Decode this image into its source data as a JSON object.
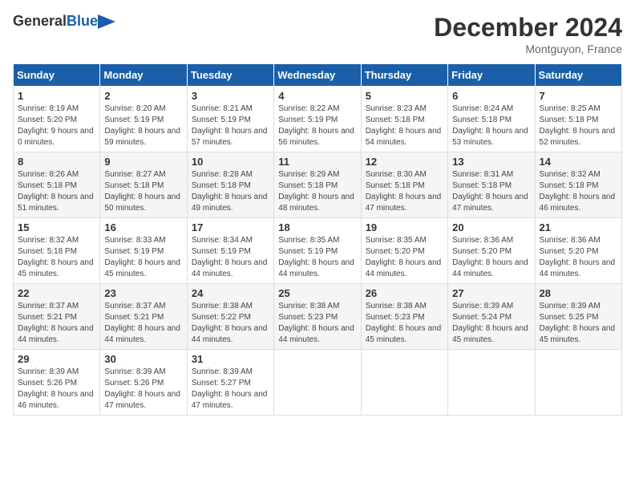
{
  "header": {
    "logo_general": "General",
    "logo_blue": "Blue",
    "month_title": "December 2024",
    "location": "Montguyon, France"
  },
  "days_of_week": [
    "Sunday",
    "Monday",
    "Tuesday",
    "Wednesday",
    "Thursday",
    "Friday",
    "Saturday"
  ],
  "weeks": [
    [
      {
        "day": "1",
        "sunrise": "Sunrise: 8:19 AM",
        "sunset": "Sunset: 5:20 PM",
        "daylight": "Daylight: 9 hours and 0 minutes."
      },
      {
        "day": "2",
        "sunrise": "Sunrise: 8:20 AM",
        "sunset": "Sunset: 5:19 PM",
        "daylight": "Daylight: 8 hours and 59 minutes."
      },
      {
        "day": "3",
        "sunrise": "Sunrise: 8:21 AM",
        "sunset": "Sunset: 5:19 PM",
        "daylight": "Daylight: 8 hours and 57 minutes."
      },
      {
        "day": "4",
        "sunrise": "Sunrise: 8:22 AM",
        "sunset": "Sunset: 5:19 PM",
        "daylight": "Daylight: 8 hours and 56 minutes."
      },
      {
        "day": "5",
        "sunrise": "Sunrise: 8:23 AM",
        "sunset": "Sunset: 5:18 PM",
        "daylight": "Daylight: 8 hours and 54 minutes."
      },
      {
        "day": "6",
        "sunrise": "Sunrise: 8:24 AM",
        "sunset": "Sunset: 5:18 PM",
        "daylight": "Daylight: 8 hours and 53 minutes."
      },
      {
        "day": "7",
        "sunrise": "Sunrise: 8:25 AM",
        "sunset": "Sunset: 5:18 PM",
        "daylight": "Daylight: 8 hours and 52 minutes."
      }
    ],
    [
      {
        "day": "8",
        "sunrise": "Sunrise: 8:26 AM",
        "sunset": "Sunset: 5:18 PM",
        "daylight": "Daylight: 8 hours and 51 minutes."
      },
      {
        "day": "9",
        "sunrise": "Sunrise: 8:27 AM",
        "sunset": "Sunset: 5:18 PM",
        "daylight": "Daylight: 8 hours and 50 minutes."
      },
      {
        "day": "10",
        "sunrise": "Sunrise: 8:28 AM",
        "sunset": "Sunset: 5:18 PM",
        "daylight": "Daylight: 8 hours and 49 minutes."
      },
      {
        "day": "11",
        "sunrise": "Sunrise: 8:29 AM",
        "sunset": "Sunset: 5:18 PM",
        "daylight": "Daylight: 8 hours and 48 minutes."
      },
      {
        "day": "12",
        "sunrise": "Sunrise: 8:30 AM",
        "sunset": "Sunset: 5:18 PM",
        "daylight": "Daylight: 8 hours and 47 minutes."
      },
      {
        "day": "13",
        "sunrise": "Sunrise: 8:31 AM",
        "sunset": "Sunset: 5:18 PM",
        "daylight": "Daylight: 8 hours and 47 minutes."
      },
      {
        "day": "14",
        "sunrise": "Sunrise: 8:32 AM",
        "sunset": "Sunset: 5:18 PM",
        "daylight": "Daylight: 8 hours and 46 minutes."
      }
    ],
    [
      {
        "day": "15",
        "sunrise": "Sunrise: 8:32 AM",
        "sunset": "Sunset: 5:18 PM",
        "daylight": "Daylight: 8 hours and 45 minutes."
      },
      {
        "day": "16",
        "sunrise": "Sunrise: 8:33 AM",
        "sunset": "Sunset: 5:19 PM",
        "daylight": "Daylight: 8 hours and 45 minutes."
      },
      {
        "day": "17",
        "sunrise": "Sunrise: 8:34 AM",
        "sunset": "Sunset: 5:19 PM",
        "daylight": "Daylight: 8 hours and 44 minutes."
      },
      {
        "day": "18",
        "sunrise": "Sunrise: 8:35 AM",
        "sunset": "Sunset: 5:19 PM",
        "daylight": "Daylight: 8 hours and 44 minutes."
      },
      {
        "day": "19",
        "sunrise": "Sunrise: 8:35 AM",
        "sunset": "Sunset: 5:20 PM",
        "daylight": "Daylight: 8 hours and 44 minutes."
      },
      {
        "day": "20",
        "sunrise": "Sunrise: 8:36 AM",
        "sunset": "Sunset: 5:20 PM",
        "daylight": "Daylight: 8 hours and 44 minutes."
      },
      {
        "day": "21",
        "sunrise": "Sunrise: 8:36 AM",
        "sunset": "Sunset: 5:20 PM",
        "daylight": "Daylight: 8 hours and 44 minutes."
      }
    ],
    [
      {
        "day": "22",
        "sunrise": "Sunrise: 8:37 AM",
        "sunset": "Sunset: 5:21 PM",
        "daylight": "Daylight: 8 hours and 44 minutes."
      },
      {
        "day": "23",
        "sunrise": "Sunrise: 8:37 AM",
        "sunset": "Sunset: 5:21 PM",
        "daylight": "Daylight: 8 hours and 44 minutes."
      },
      {
        "day": "24",
        "sunrise": "Sunrise: 8:38 AM",
        "sunset": "Sunset: 5:22 PM",
        "daylight": "Daylight: 8 hours and 44 minutes."
      },
      {
        "day": "25",
        "sunrise": "Sunrise: 8:38 AM",
        "sunset": "Sunset: 5:23 PM",
        "daylight": "Daylight: 8 hours and 44 minutes."
      },
      {
        "day": "26",
        "sunrise": "Sunrise: 8:38 AM",
        "sunset": "Sunset: 5:23 PM",
        "daylight": "Daylight: 8 hours and 45 minutes."
      },
      {
        "day": "27",
        "sunrise": "Sunrise: 8:39 AM",
        "sunset": "Sunset: 5:24 PM",
        "daylight": "Daylight: 8 hours and 45 minutes."
      },
      {
        "day": "28",
        "sunrise": "Sunrise: 8:39 AM",
        "sunset": "Sunset: 5:25 PM",
        "daylight": "Daylight: 8 hours and 45 minutes."
      }
    ],
    [
      {
        "day": "29",
        "sunrise": "Sunrise: 8:39 AM",
        "sunset": "Sunset: 5:26 PM",
        "daylight": "Daylight: 8 hours and 46 minutes."
      },
      {
        "day": "30",
        "sunrise": "Sunrise: 8:39 AM",
        "sunset": "Sunset: 5:26 PM",
        "daylight": "Daylight: 8 hours and 47 minutes."
      },
      {
        "day": "31",
        "sunrise": "Sunrise: 8:39 AM",
        "sunset": "Sunset: 5:27 PM",
        "daylight": "Daylight: 8 hours and 47 minutes."
      },
      null,
      null,
      null,
      null
    ]
  ]
}
